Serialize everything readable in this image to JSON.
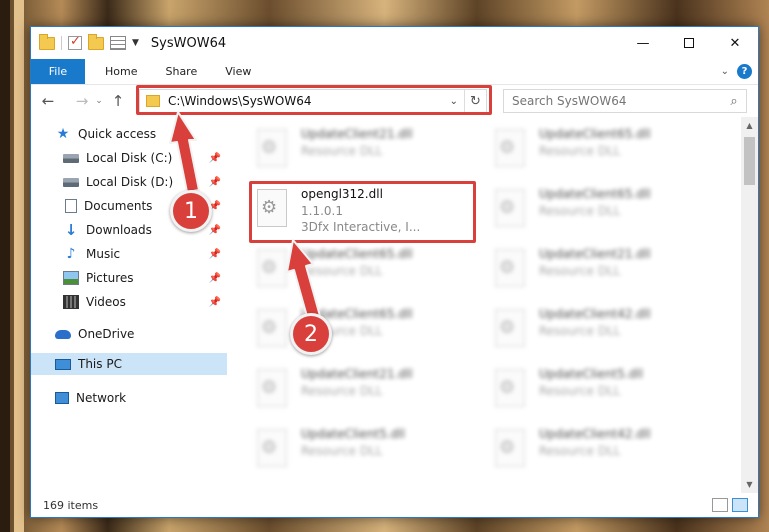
{
  "window": {
    "title": "SysWOW64",
    "controls": {
      "minimize": "—",
      "maximize": "",
      "close": "✕"
    }
  },
  "ribbon": {
    "file_tab": "File",
    "tabs": [
      "Home",
      "Share",
      "View"
    ],
    "help": "?"
  },
  "navigation": {
    "back": "←",
    "forward": "→",
    "recent": "⌄",
    "up": "↑",
    "address": "C:\\Windows\\SysWOW64",
    "address_dropdown": "⌄",
    "refresh": "↻",
    "search_placeholder": "Search SysWOW64"
  },
  "sidebar": {
    "items": [
      {
        "label": "Quick access",
        "icon": "star-icon",
        "pinned": false
      },
      {
        "label": "Local Disk (C:)",
        "icon": "disk-icon",
        "pinned": true
      },
      {
        "label": "Local Disk (D:)",
        "icon": "disk-icon",
        "pinned": true
      },
      {
        "label": "Documents",
        "icon": "document-icon",
        "pinned": true
      },
      {
        "label": "Downloads",
        "icon": "download-icon",
        "pinned": true
      },
      {
        "label": "Music",
        "icon": "music-icon",
        "pinned": true
      },
      {
        "label": "Pictures",
        "icon": "pictures-icon",
        "pinned": true
      },
      {
        "label": "Videos",
        "icon": "videos-icon",
        "pinned": true
      },
      {
        "label": "OneDrive",
        "icon": "cloud-icon",
        "pinned": false
      },
      {
        "label": "This PC",
        "icon": "pc-icon",
        "pinned": false
      },
      {
        "label": "Network",
        "icon": "network-icon",
        "pinned": false
      }
    ],
    "pin_glyph": "📌"
  },
  "files": {
    "highlighted": {
      "name": "opengl312.dll",
      "version": "1.1.0.1",
      "company": "3Dfx Interactive, I..."
    },
    "blurred": [
      {
        "name": "UpdateClient21.dll",
        "type": "Resource DLL"
      },
      {
        "name": "UpdateClient65.dll",
        "type": "Resource DLL"
      },
      {
        "name": "UpdateClient65.dll",
        "type": "Resource DLL"
      },
      {
        "name": "UpdateClient65.dll",
        "type": "Resource DLL"
      },
      {
        "name": "UpdateClient21.dll",
        "type": "Resource DLL"
      },
      {
        "name": "UpdateClient65.dll",
        "type": "Resource DLL"
      },
      {
        "name": "UpdateClient42.dll",
        "type": "Resource DLL"
      },
      {
        "name": "UpdateClient21.dll",
        "type": "Resource DLL"
      },
      {
        "name": "UpdateClient5.dll",
        "type": "Resource DLL"
      },
      {
        "name": "UpdateClient5.dll",
        "type": "Resource DLL"
      },
      {
        "name": "UpdateClient42.dll",
        "type": "Resource DLL"
      }
    ]
  },
  "status": {
    "item_count": "169 items"
  },
  "callouts": [
    {
      "number": "1"
    },
    {
      "number": "2"
    }
  ],
  "colors": {
    "accent": "#1979ca",
    "callout": "#d9403b",
    "selection": "#cce4f7"
  }
}
